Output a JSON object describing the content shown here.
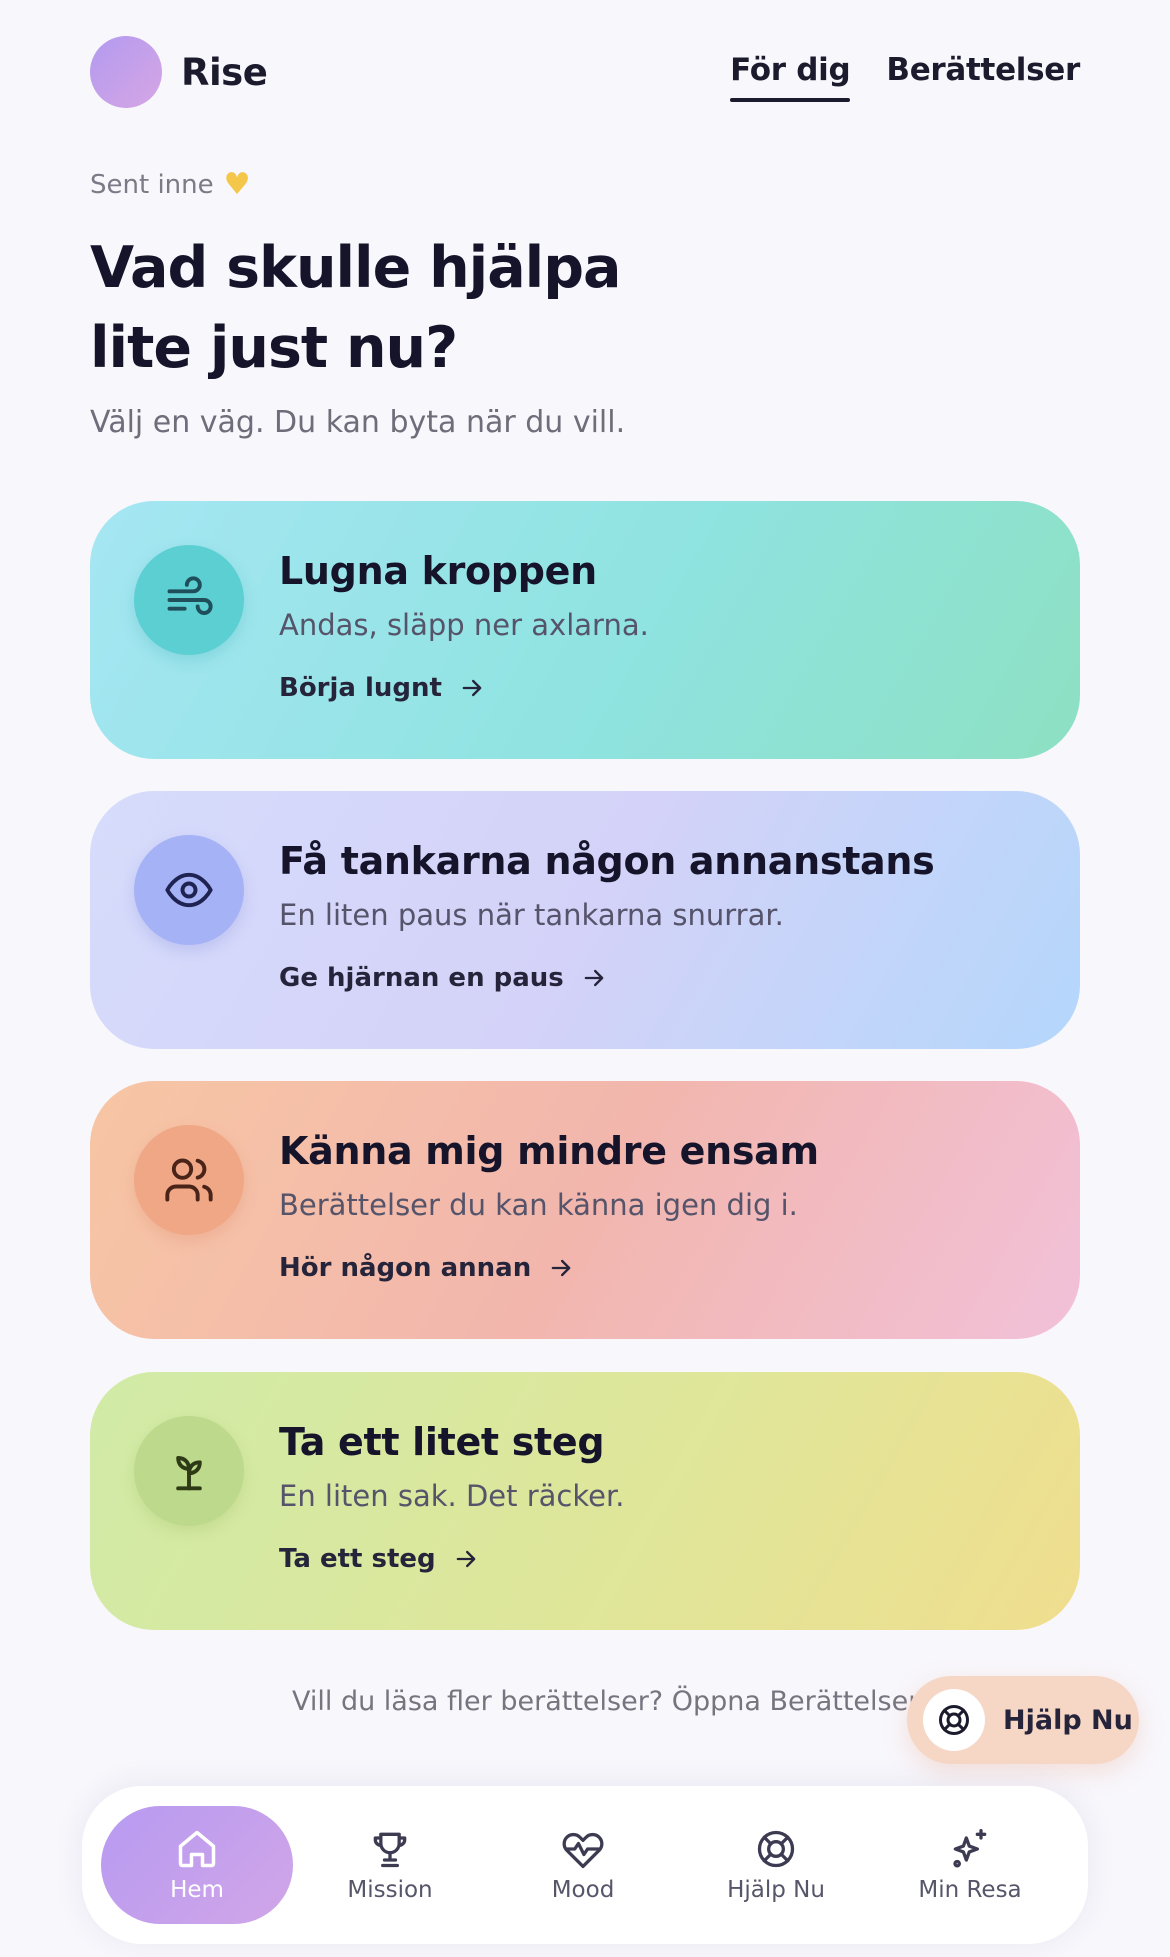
{
  "header": {
    "brand": "Rise",
    "tabs": [
      {
        "label": "För dig",
        "active": true
      },
      {
        "label": "Berättelser",
        "active": false
      }
    ]
  },
  "intro": {
    "eyebrow": "Sent inne",
    "eyebrow_icon": "yellow-heart-icon",
    "headline_line1": "Vad skulle hjälpa",
    "headline_line2": "lite just nu?",
    "subline": "Välj en väg. Du kan byta när du vill."
  },
  "cards": [
    {
      "title": "Lugna kroppen",
      "description": "Andas, släpp ner axlarna.",
      "cta": "Börja lugnt",
      "icon": "wind-icon"
    },
    {
      "title": "Få tankarna någon annanstans",
      "description": "En liten paus när tankarna snurrar.",
      "cta": "Ge hjärnan en paus",
      "icon": "eye-icon"
    },
    {
      "title": "Känna mig mindre ensam",
      "description": "Berättelser du kan känna igen dig i.",
      "cta": "Hör någon annan",
      "icon": "users-icon"
    },
    {
      "title": "Ta ett litet steg",
      "description": "En liten sak. Det räcker.",
      "cta": "Ta ett steg",
      "icon": "sprout-icon"
    }
  ],
  "more_prompt": "Vill du läsa fler berättelser? Öppna Berättelser",
  "help_pill": {
    "label": "Hjälp Nu",
    "icon": "lifebuoy-icon"
  },
  "bottom_nav": [
    {
      "label": "Hem",
      "icon": "home-icon",
      "active": true
    },
    {
      "label": "Mission",
      "icon": "trophy-icon",
      "active": false
    },
    {
      "label": "Mood",
      "icon": "heart-pulse-icon",
      "active": false
    },
    {
      "label": "Hjälp Nu",
      "icon": "lifebuoy-icon",
      "active": false
    },
    {
      "label": "Min Resa",
      "icon": "sparkles-icon",
      "active": false
    }
  ],
  "colors": {
    "text_primary": "#15142a",
    "accent_purple": "#b79af1",
    "card_calm": "#8fe3e0",
    "card_mind": "#d4d2f8",
    "card_lonely": "#f2b6ad",
    "card_step": "#dfe69a",
    "help_pill": "#f6d6c5"
  }
}
